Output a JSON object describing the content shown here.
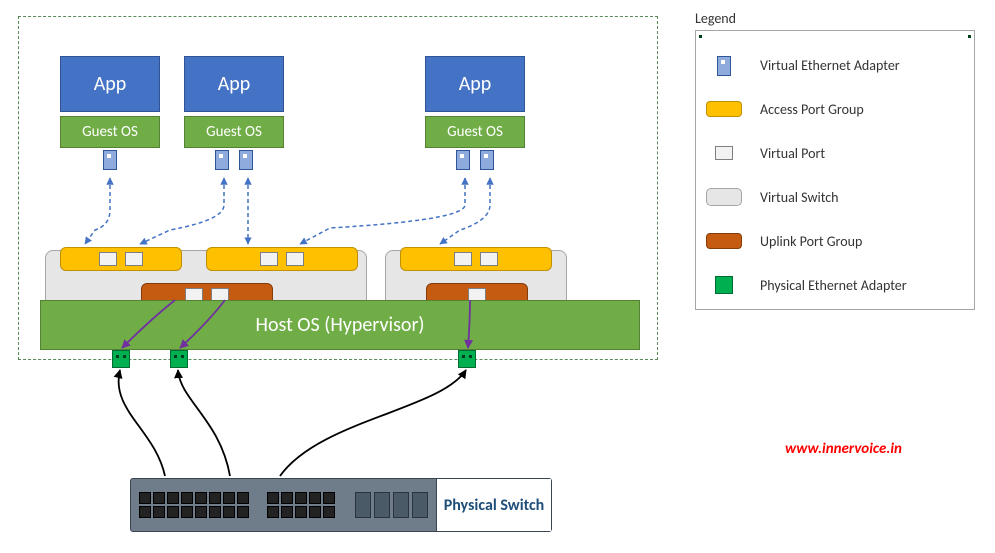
{
  "vms": [
    {
      "app_label": "App",
      "guest_label": "Guest OS",
      "veth_count": 1
    },
    {
      "app_label": "App",
      "guest_label": "Guest OS",
      "veth_count": 2
    },
    {
      "app_label": "App",
      "guest_label": "Guest OS",
      "veth_count": 2
    }
  ],
  "vswitches": [
    {
      "access_port_groups": 2,
      "access_ports_per_group": 2,
      "uplink_ports": 2
    },
    {
      "access_port_groups": 1,
      "access_ports_per_group": 2,
      "uplink_ports": 1
    }
  ],
  "host_label": "Host OS (Hypervisor)",
  "physical_adapters": 3,
  "physical_switch_label": "Physical Switch",
  "legend": {
    "title": "Legend",
    "items": [
      {
        "key": "veth",
        "label": "Virtual Ethernet Adapter"
      },
      {
        "key": "access",
        "label": "Access Port Group"
      },
      {
        "key": "vport",
        "label": "Virtual Port"
      },
      {
        "key": "vswitch",
        "label": "Virtual Switch"
      },
      {
        "key": "uplink",
        "label": "Uplink Port Group"
      },
      {
        "key": "peth",
        "label": "Physical Ethernet Adapter"
      }
    ]
  },
  "watermark": "www.innervoice.in",
  "colors": {
    "app": "#4472C4",
    "guest": "#70AD47",
    "access": "#FFC000",
    "uplink": "#C55A11",
    "vswitch_bg": "#E7E6E6",
    "peth": "#00B050",
    "link_dashed": "#4472C4",
    "link_purple": "#7030A0",
    "link_black": "#000000"
  }
}
